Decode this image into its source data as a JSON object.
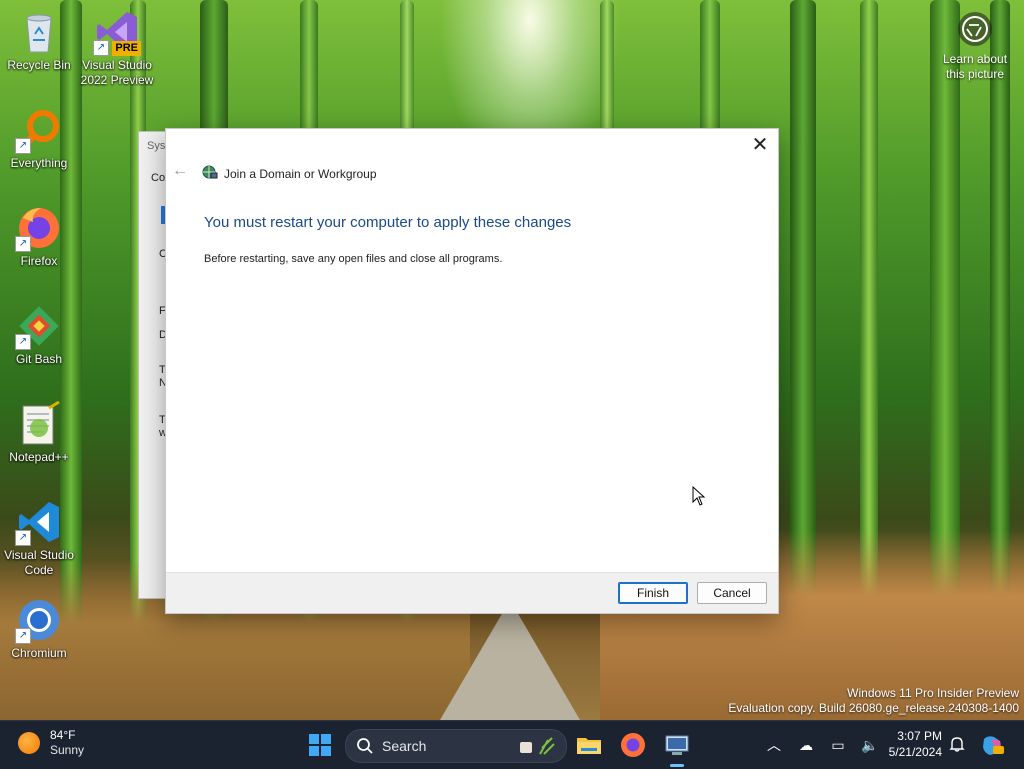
{
  "desktop_icons": [
    {
      "label": "Recycle Bin",
      "icon": "recycle-bin-icon"
    },
    {
      "label": "Visual Studio 2022 Preview",
      "icon": "visual-studio-preview-icon",
      "badge": "PRE"
    },
    {
      "label": "Everything",
      "icon": "everything-search-icon"
    },
    {
      "label": "Firefox",
      "icon": "firefox-icon"
    },
    {
      "label": "Git Bash",
      "icon": "git-bash-icon"
    },
    {
      "label": "Notepad++",
      "icon": "notepad-plus-plus-icon"
    },
    {
      "label": "Visual Studio Code",
      "icon": "vscode-icon"
    },
    {
      "label": "Chromium",
      "icon": "chromium-icon"
    }
  ],
  "learn_about": {
    "label": "Learn about this picture",
    "icon": "camera-lens-icon"
  },
  "background_window": {
    "title_fragment": "Sys",
    "fragments": [
      "Co",
      "C",
      "F",
      "D",
      "T",
      "N",
      "T",
      "w"
    ]
  },
  "dialog": {
    "title": "Join a Domain or Workgroup",
    "heading": "You must restart your computer to apply these changes",
    "body": "Before restarting, save any open files and close all programs.",
    "finish_label": "Finish",
    "cancel_label": "Cancel",
    "close_glyph": "✕",
    "back_glyph": "←"
  },
  "watermark": {
    "line1": "Windows 11 Pro Insider Preview",
    "line2": "Evaluation copy. Build 26080.ge_release.240308-1400"
  },
  "taskbar": {
    "weather_temp": "84°F",
    "weather_condition": "Sunny",
    "search_placeholder": "Search",
    "pinned_apps": [
      "file-explorer-icon",
      "firefox-icon",
      "system-properties-icon"
    ],
    "time": "3:07 PM",
    "date": "5/21/2024"
  },
  "colors": {
    "accent": "#1a73c8",
    "heading_blue": "#1a4a8a",
    "taskbar_bg": "#1b2230"
  }
}
